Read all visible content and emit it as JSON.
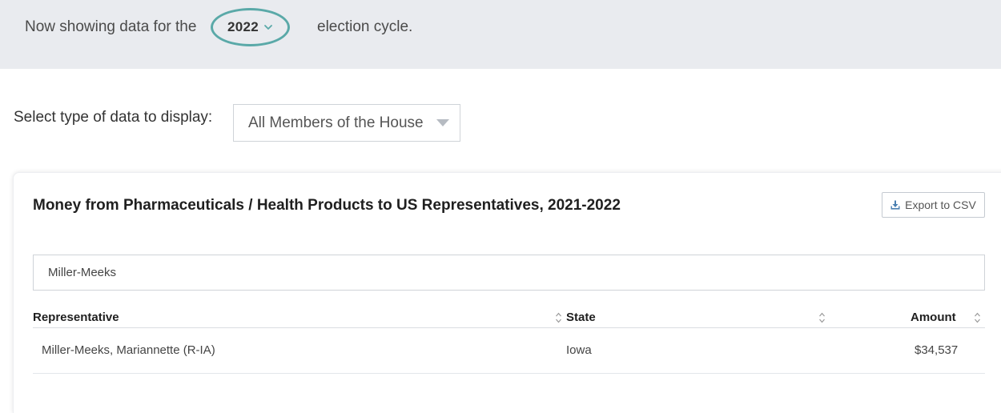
{
  "cycle_bar": {
    "prefix": "Now showing data for the",
    "year": "2022",
    "suffix": "election cycle."
  },
  "type_selector": {
    "label": "Select type of data to display:",
    "value": "All Members of the House"
  },
  "table_card": {
    "title": "Money from Pharmaceuticals / Health Products to US Representatives, 2021-2022",
    "export_label": "Export to CSV",
    "search_value": "Miller-Meeks",
    "columns": [
      "Representative",
      "State",
      "Amount"
    ],
    "rows": [
      {
        "representative": "Miller-Meeks, Mariannette (R-IA)",
        "state": "Iowa",
        "amount": "$34,537"
      }
    ]
  },
  "colors": {
    "accent_teal": "#5aa9a8",
    "top_band_bg": "#e9ebef",
    "export_icon": "#4a7fb0"
  },
  "icons": {
    "cycle_dropdown": "chevron-down-icon",
    "type_dropdown": "caret-down-icon",
    "export": "download-icon",
    "sort": "sort-icon"
  }
}
